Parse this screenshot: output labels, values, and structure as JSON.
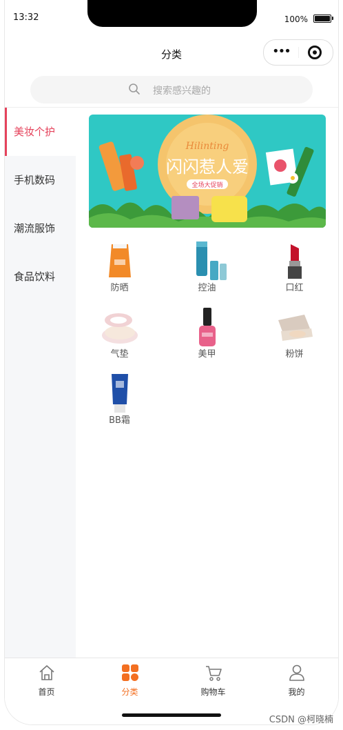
{
  "status_bar": {
    "time": "13:32",
    "battery": "100%"
  },
  "navbar": {
    "title": "分类"
  },
  "search": {
    "placeholder": "搜索感兴趣的"
  },
  "sidebar": {
    "items": [
      {
        "label": "美妆个护",
        "active": true
      },
      {
        "label": "手机数码",
        "active": false
      },
      {
        "label": "潮流服饰",
        "active": false
      },
      {
        "label": "食品饮料",
        "active": false
      }
    ]
  },
  "banner": {
    "script_text": "Hilinting",
    "headline": "闪闪惹人爱",
    "promo": "全场大促销"
  },
  "products": [
    {
      "label": "防晒",
      "icon": "sunscreen-icon"
    },
    {
      "label": "控油",
      "icon": "oil-control-icon"
    },
    {
      "label": "口红",
      "icon": "lipstick-icon"
    },
    {
      "label": "气垫",
      "icon": "cushion-icon"
    },
    {
      "label": "美甲",
      "icon": "nail-polish-icon"
    },
    {
      "label": "粉饼",
      "icon": "pressed-powder-icon"
    },
    {
      "label": "BB霜",
      "icon": "bb-cream-icon"
    }
  ],
  "tabbar": {
    "items": [
      {
        "label": "首页",
        "icon": "home-icon",
        "active": false
      },
      {
        "label": "分类",
        "icon": "category-icon",
        "active": true
      },
      {
        "label": "购物车",
        "icon": "cart-icon",
        "active": false
      },
      {
        "label": "我的",
        "icon": "user-icon",
        "active": false
      }
    ]
  },
  "colors": {
    "accent": "#e5425b",
    "tab_active": "#f36f21",
    "banner_bg": "#2fc8c4"
  },
  "watermark": "CSDN @柯晓楠"
}
